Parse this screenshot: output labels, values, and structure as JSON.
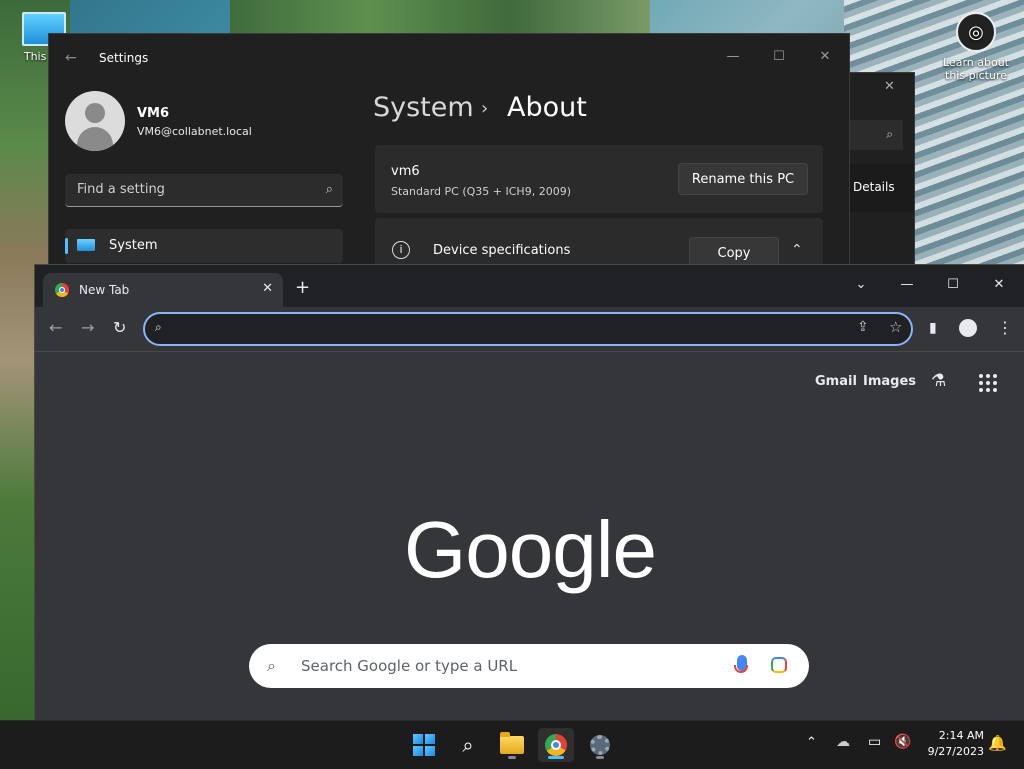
{
  "desktop": {
    "icon_this_pc": "This PC",
    "icon_learn": "Learn about this picture"
  },
  "settings": {
    "window_title": "Settings",
    "user_name": "VM6",
    "user_email": "VM6@collabnet.local",
    "search_placeholder": "Find a setting",
    "nav_selected": "System",
    "breadcrumb_parent": "System",
    "breadcrumb_current": "About",
    "pc_name": "vm6",
    "pc_model": "Standard PC (Q35 + ICH9, 2009)",
    "rename_label": "Rename this PC",
    "device_specs_label": "Device specifications",
    "copy_label": "Copy"
  },
  "background_window": {
    "details_label": "Details"
  },
  "chrome": {
    "tab_title": "New Tab",
    "omnibox_value": "",
    "links": {
      "gmail": "Gmail",
      "images": "Images"
    },
    "logo": "Google",
    "search_placeholder": "Search Google or type a URL"
  },
  "taskbar": {
    "time": "2:14 AM",
    "date": "9/27/2023"
  },
  "colors": {
    "accent": "#4cc2ff",
    "omnibox_focus": "#8ab4f8"
  }
}
